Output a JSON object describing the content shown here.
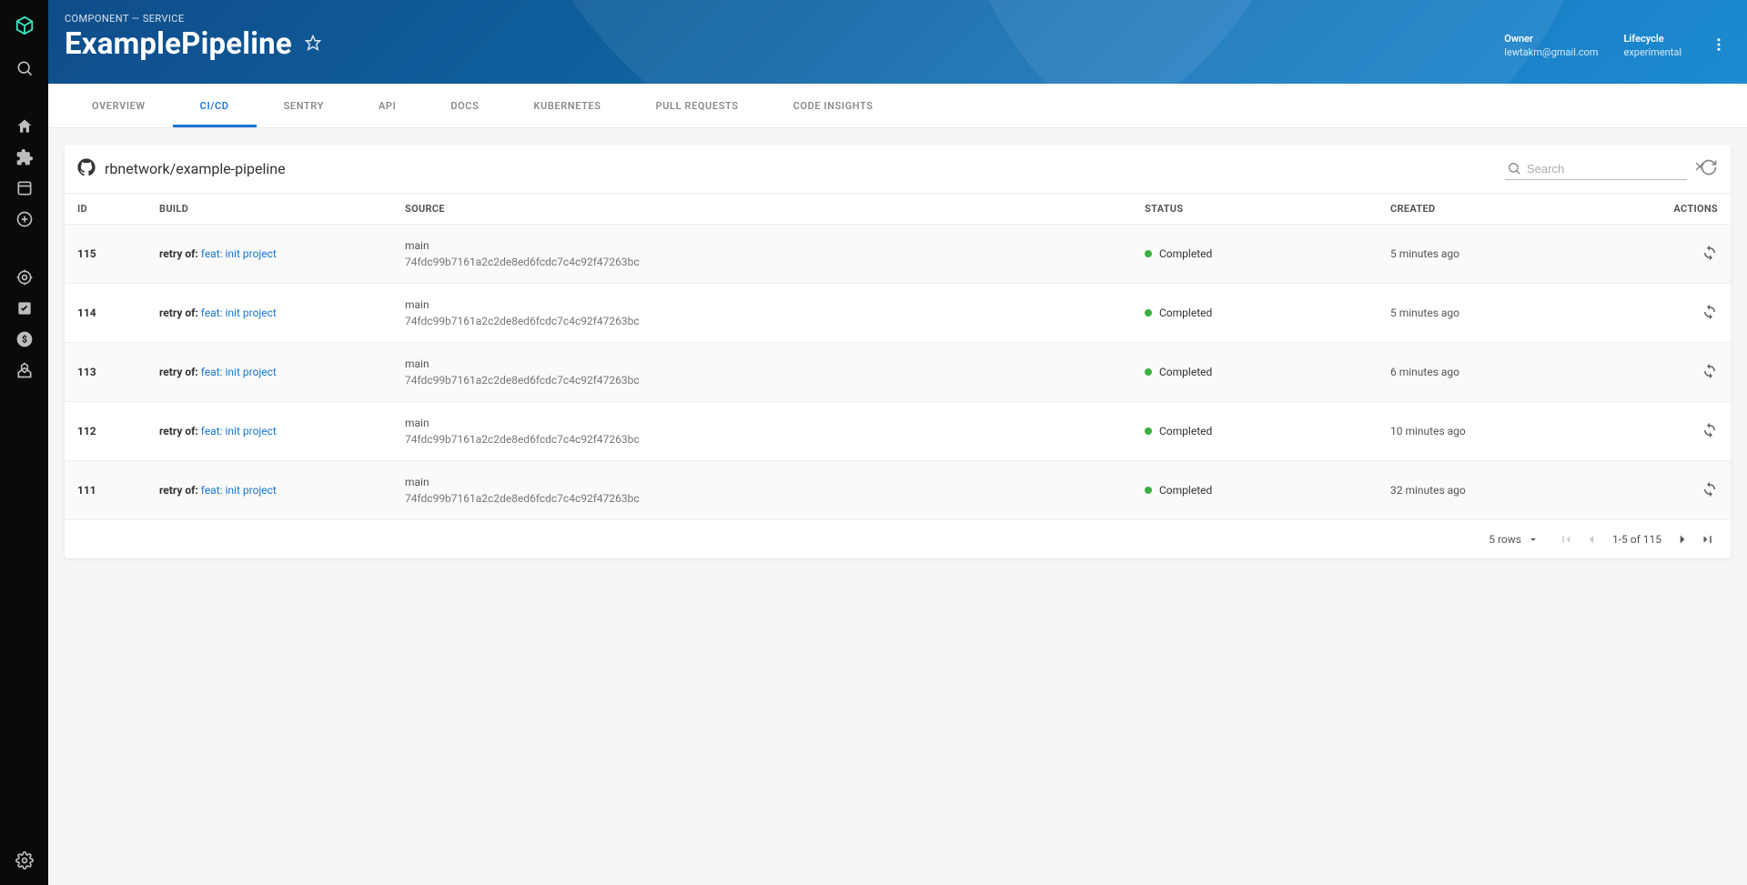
{
  "breadcrumb": "COMPONENT — SERVICE",
  "title": "ExamplePipeline",
  "owner": {
    "label": "Owner",
    "value": "lewtakm@gmail.com"
  },
  "lifecycle": {
    "label": "Lifecycle",
    "value": "experimental"
  },
  "tabs": [
    {
      "label": "OVERVIEW"
    },
    {
      "label": "CI/CD"
    },
    {
      "label": "SENTRY"
    },
    {
      "label": "API"
    },
    {
      "label": "DOCS"
    },
    {
      "label": "KUBERNETES"
    },
    {
      "label": "PULL REQUESTS"
    },
    {
      "label": "CODE INSIGHTS"
    }
  ],
  "activeTab": "CI/CD",
  "repo": "rbnetwork/example-pipeline",
  "search": {
    "placeholder": "Search",
    "value": ""
  },
  "columns": {
    "id": "ID",
    "build": "BUILD",
    "source": "SOURCE",
    "status": "STATUS",
    "created": "CREATED",
    "actions": "ACTIONS"
  },
  "retryPrefix": "retry of: ",
  "rows": [
    {
      "id": "115",
      "buildLink": "feat: init project",
      "branch": "main",
      "sha": "74fdc99b7161a2c2de8ed6fcdc7c4c92f47263bc",
      "status": "Completed",
      "created": "5 minutes ago"
    },
    {
      "id": "114",
      "buildLink": "feat: init project",
      "branch": "main",
      "sha": "74fdc99b7161a2c2de8ed6fcdc7c4c92f47263bc",
      "status": "Completed",
      "created": "5 minutes ago"
    },
    {
      "id": "113",
      "buildLink": "feat: init project",
      "branch": "main",
      "sha": "74fdc99b7161a2c2de8ed6fcdc7c4c92f47263bc",
      "status": "Completed",
      "created": "6 minutes ago"
    },
    {
      "id": "112",
      "buildLink": "feat: init project",
      "branch": "main",
      "sha": "74fdc99b7161a2c2de8ed6fcdc7c4c92f47263bc",
      "status": "Completed",
      "created": "10 minutes ago"
    },
    {
      "id": "111",
      "buildLink": "feat: init project",
      "branch": "main",
      "sha": "74fdc99b7161a2c2de8ed6fcdc7c4c92f47263bc",
      "status": "Completed",
      "created": "32 minutes ago"
    }
  ],
  "pagination": {
    "rowsLabel": "5 rows",
    "range": "1-5 of 115"
  }
}
